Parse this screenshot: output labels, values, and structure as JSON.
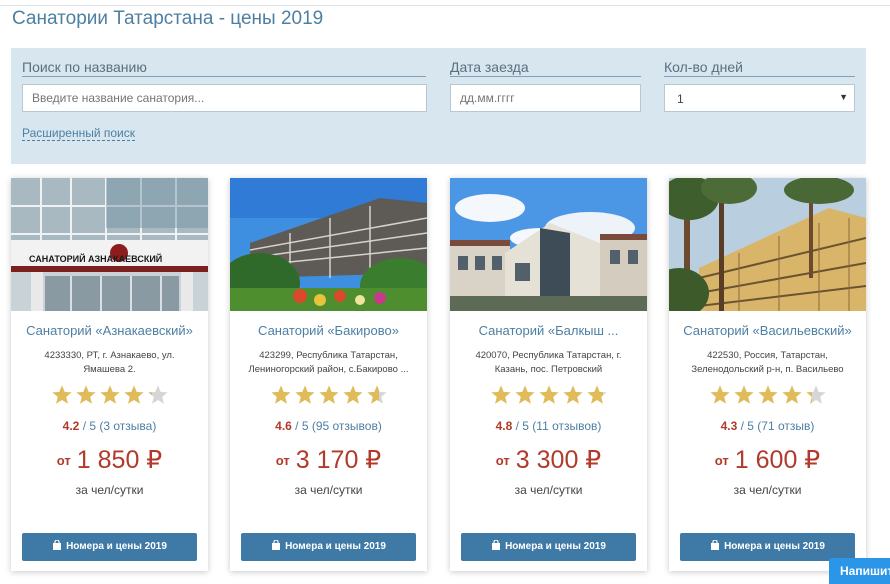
{
  "page": {
    "title": "Санатории Татарстана - цены 2019"
  },
  "search": {
    "name_label": "Поиск по названию",
    "name_placeholder": "Введите название санатория...",
    "date_label": "Дата заезда",
    "date_placeholder": "дд.мм.гггг",
    "days_label": "Кол-во дней",
    "days_value": "1",
    "advanced_link": "Расширенный поиск"
  },
  "cards": [
    {
      "name": "Санаторий «Азнакаевский»",
      "address": "4233330, РТ, г. Азнакаево, ул. Ямашева 2.",
      "rating_value": 4.2,
      "rating": "4.2",
      "rating_rest": "/ 5 (3 отзыва)",
      "price_prefix": "от",
      "price": "1 850 ₽",
      "per": "за чел/сутки",
      "button": "Номера и цены 2019",
      "sign": "САНАТОРИЙ АЗНАКАЕВСКИЙ"
    },
    {
      "name": "Санаторий «Бакирово»",
      "address": "423299, Республика Татарстан, Лениногорский район, с.Бакирово ...",
      "rating_value": 4.6,
      "rating": "4.6",
      "rating_rest": "/ 5 (95 отзывов)",
      "price_prefix": "от",
      "price": "3 170 ₽",
      "per": "за чел/сутки",
      "button": "Номера и цены 2019"
    },
    {
      "name": "Санаторий «Балкыш ...",
      "address": "420070, Республика Татарстан, г. Казань, пос. Петровский",
      "rating_value": 4.8,
      "rating": "4.8",
      "rating_rest": "/ 5 (11 отзывов)",
      "price_prefix": "от",
      "price": "3 300 ₽",
      "per": "за чел/сутки",
      "button": "Номера и цены 2019"
    },
    {
      "name": "Санаторий «Васильевский»",
      "address": "422530, Россия, Татарстан, Зеленодольский р-н, п. Васильево",
      "rating_value": 4.3,
      "rating": "4.3",
      "rating_rest": "/ 5 (71 отзыв)",
      "price_prefix": "от",
      "price": "1 600 ₽",
      "per": "за чел/сутки",
      "button": "Номера и цены 2019"
    }
  ],
  "chat": {
    "label": "Напишите"
  },
  "colors": {
    "accent": "#4d7fa3",
    "price": "#b13a2b",
    "star": "#e0bb5a",
    "star_empty": "#d6d6d6",
    "button": "#3f7aa7",
    "panel": "#d8e6ef",
    "chat": "#2b96e8"
  },
  "icons": {
    "button_icon": "shopping-bag-icon",
    "select_icon": "chevron-down-icon"
  }
}
